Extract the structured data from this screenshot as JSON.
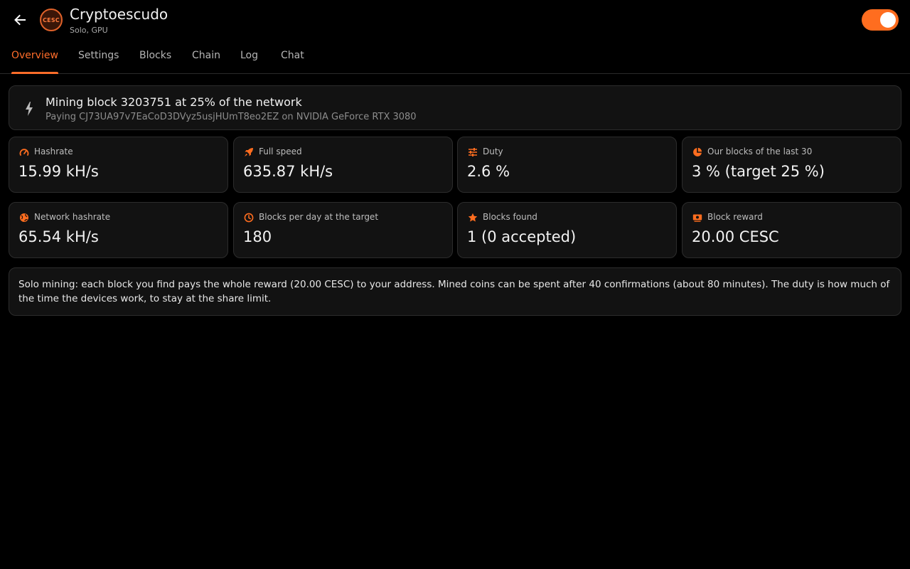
{
  "header": {
    "title": "Cryptoescudo",
    "subtitle": "Solo, GPU",
    "coin_label": "CESC",
    "toggle_on": true,
    "accent_color": "#ff6d1f"
  },
  "tabs": [
    {
      "label": "Overview",
      "active": true
    },
    {
      "label": "Settings",
      "active": false
    },
    {
      "label": "Blocks",
      "active": false
    },
    {
      "label": "Chain",
      "active": false
    },
    {
      "label": "Log",
      "active": false
    },
    {
      "label": "Chat",
      "active": false
    }
  ],
  "status": {
    "icon": "bolt-icon",
    "main": "Mining block 3203751 at 25% of the network",
    "sub": "Paying CJ73UA97v7EaCoD3DVyz5usjHUmT8eo2EZ on NVIDIA GeForce RTX 3080"
  },
  "stats": [
    {
      "icon": "speedometer-icon",
      "label": "Hashrate",
      "value": "15.99 kH/s"
    },
    {
      "icon": "rocket-icon",
      "label": "Full speed",
      "value": "635.87 kH/s"
    },
    {
      "icon": "sliders-icon",
      "label": "Duty",
      "value": "2.6 %"
    },
    {
      "icon": "pie-chart-icon",
      "label": "Our blocks of the last 30",
      "value": "3 % (target 25 %)"
    },
    {
      "icon": "globe-icon",
      "label": "Network hashrate",
      "value": "65.54 kH/s"
    },
    {
      "icon": "clock-icon",
      "label": "Blocks per day at the target",
      "value": "180"
    },
    {
      "icon": "star-icon",
      "label": "Blocks found",
      "value": "1 (0 accepted)"
    },
    {
      "icon": "payments-icon",
      "label": "Block reward",
      "value": "20.00 CESC"
    }
  ],
  "info": {
    "text": "Solo mining: each block you find pays the whole reward (20.00 CESC) to your address. Mined coins can be spent after 40 confirmations (about 80 minutes). The duty is how much of the time the devices work, to stay at the share limit."
  }
}
